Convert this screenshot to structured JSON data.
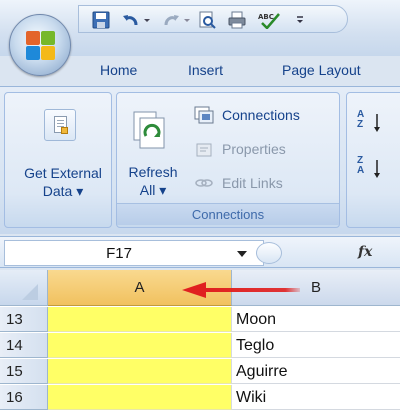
{
  "tabs": [
    {
      "label": "Home"
    },
    {
      "label": "Insert"
    },
    {
      "label": "Page Layout"
    }
  ],
  "ribbon": {
    "get_external_data": {
      "line1": "Get External",
      "line2": "Data ▾"
    },
    "connections_group": {
      "label": "Connections",
      "refresh": {
        "line1": "Refresh",
        "line2": "All ▾"
      },
      "connections": "Connections",
      "properties": "Properties",
      "edit_links": "Edit Links"
    },
    "sort": {
      "az": {
        "top": "A",
        "bottom": "Z"
      },
      "za": {
        "top": "Z",
        "bottom": "A"
      }
    }
  },
  "formula_bar": {
    "name_box": "F17",
    "fx": "fx"
  },
  "sheet": {
    "columns": [
      "A",
      "B"
    ],
    "rows": [
      {
        "num": "13",
        "a": "",
        "b": "Moon"
      },
      {
        "num": "14",
        "a": "",
        "b": "Teglo"
      },
      {
        "num": "15",
        "a": "",
        "b": "Aguirre"
      },
      {
        "num": "16",
        "a": "",
        "b": "Wiki"
      }
    ]
  },
  "colors": {
    "highlight": "#ffff66",
    "arrow": "#e02020",
    "selected_header": "#f1c15f"
  },
  "icons": [
    "office-button-icon",
    "save-icon",
    "undo-icon",
    "redo-icon",
    "print-preview-icon",
    "print-icon",
    "spelling-icon",
    "get-external-data-icon",
    "refresh-icon",
    "connections-icon",
    "properties-icon",
    "edit-links-icon",
    "sort-az-icon",
    "sort-za-icon"
  ]
}
